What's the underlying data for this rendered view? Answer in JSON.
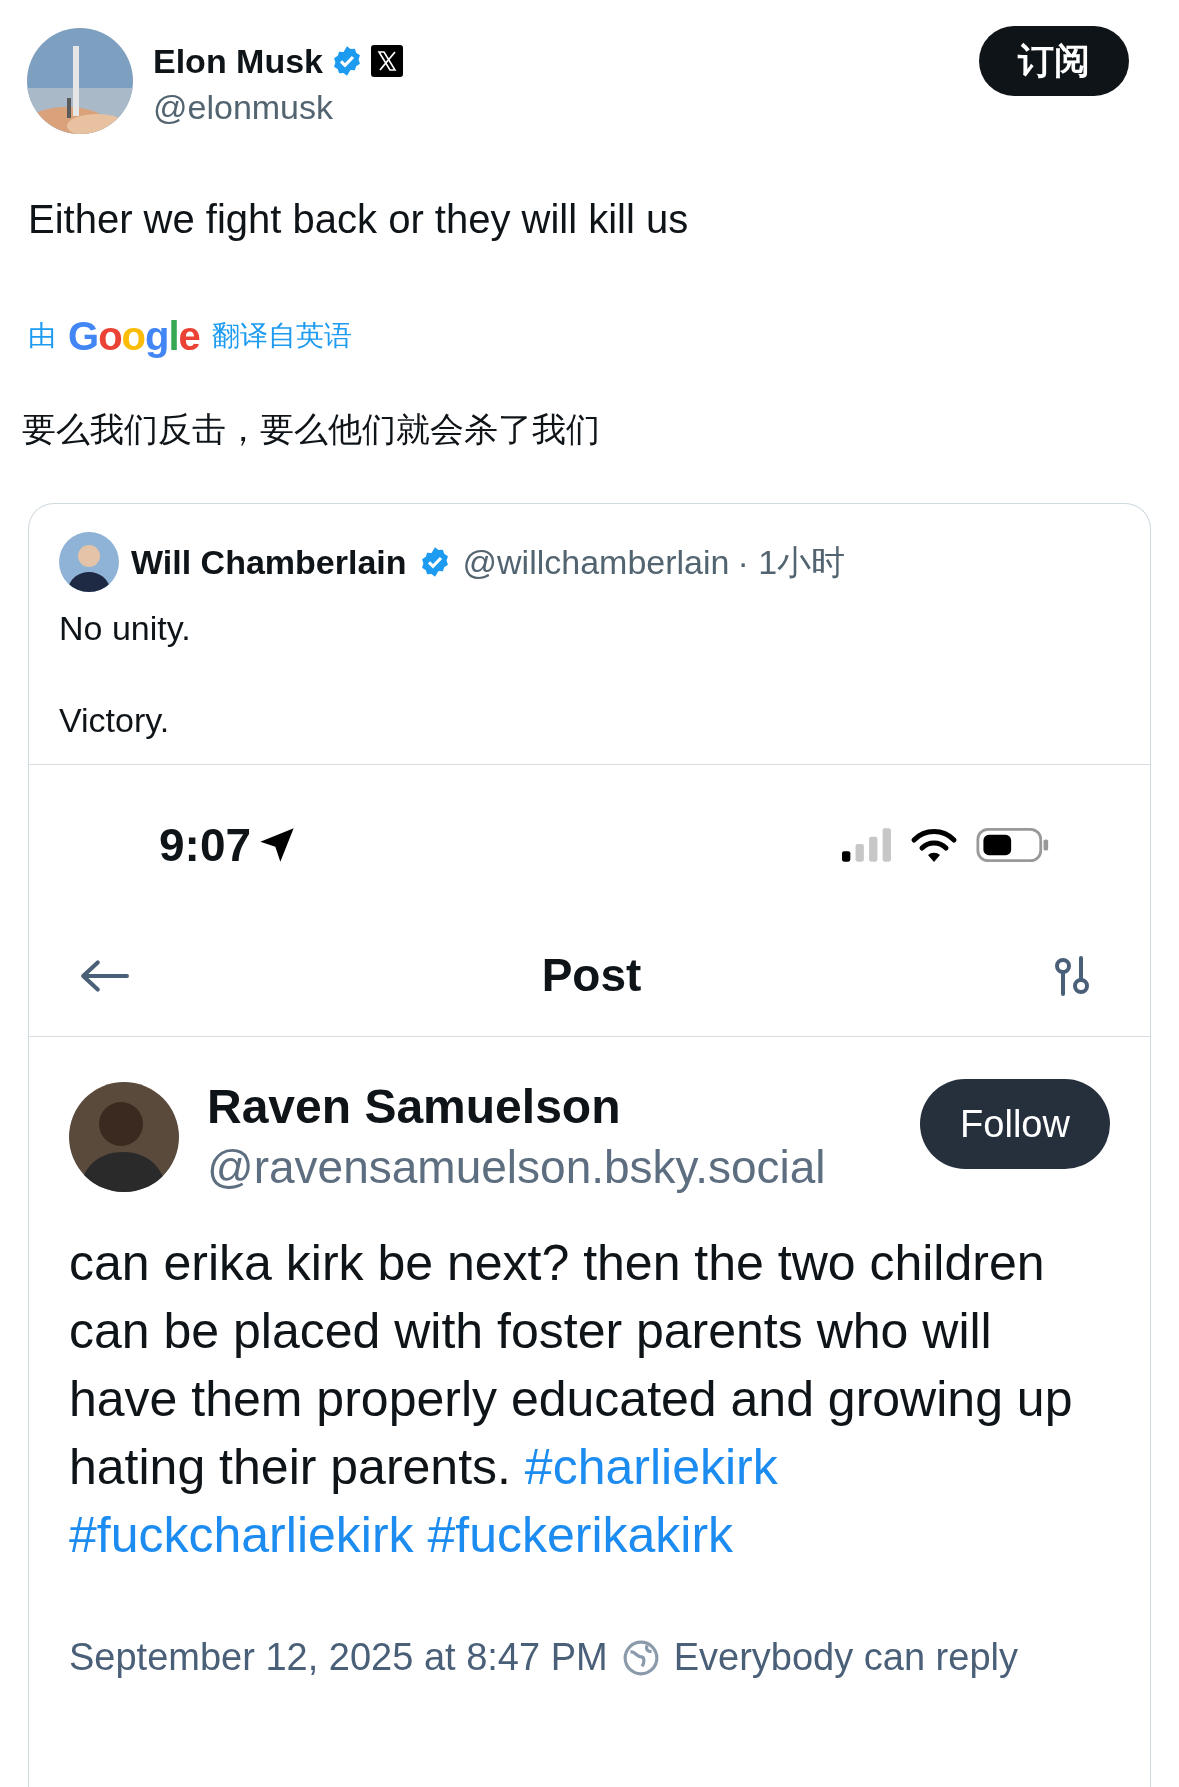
{
  "author": {
    "name": "Elon Musk",
    "handle": "@elonmusk",
    "verified": true
  },
  "subscribe_button": "订阅",
  "tweet_text": "Either we fight back or they will kill us",
  "translation": {
    "prefix": "由",
    "brand": "Google",
    "suffix": "翻译自英语",
    "text": "要么我们反击，要么他们就会杀了我们"
  },
  "quoted": {
    "name": "Will Chamberlain",
    "verified": true,
    "handle": "@willchamberlain",
    "time": "· 1小时",
    "lines": [
      "No unity.",
      "Victory."
    ],
    "screenshot": {
      "status_time": "9:07",
      "title": "Post",
      "post": {
        "name": "Raven Samuelson",
        "handle": "@ravensamuelson.bsky.social",
        "follow_button": "Follow",
        "text": "can erika kirk be next? then the two children can be placed with foster parents who will have them properly educated and growing up hating their parents.",
        "hashtags": [
          "#charliekirk",
          "#fuckcharliekirk",
          "#fuckerikakirk"
        ],
        "date": "September 12, 2025 at 8:47 PM",
        "reply_setting": "Everybody can reply"
      }
    }
  }
}
